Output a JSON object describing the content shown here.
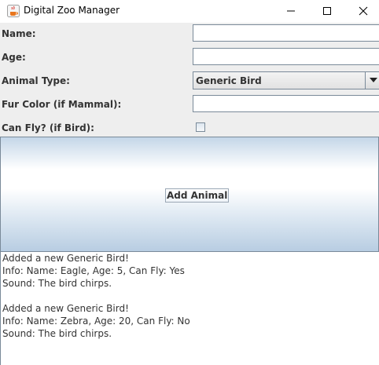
{
  "window": {
    "title": "Digital Zoo Manager",
    "controls": {
      "minimize": "minimize",
      "maximize": "maximize",
      "close": "close"
    }
  },
  "form": {
    "name_label": "Name:",
    "name_value": "",
    "age_label": "Age:",
    "age_value": "",
    "type_label": "Animal Type:",
    "type_selected": "Generic Bird",
    "fur_label": "Fur Color (if Mammal):",
    "fur_value": "",
    "fly_label": "Can Fly? (if Bird):",
    "fly_checked": false
  },
  "add_button_label": "Add Animal",
  "output": {
    "lines": [
      "Added a new Generic Bird!",
      "Info: Name: Eagle, Age: 5, Can Fly: Yes",
      "Sound: The bird chirps.",
      "",
      "Added a new Generic Bird!",
      "Info: Name: Zebra, Age: 20, Can Fly: No",
      "Sound: The bird chirps."
    ]
  },
  "colors": {
    "window_bg": "#eeeeee",
    "field_border": "#7a8a99",
    "button_gradient_light": "#ffffff",
    "button_gradient_blue": "#b8cde2",
    "text": "#333333"
  }
}
